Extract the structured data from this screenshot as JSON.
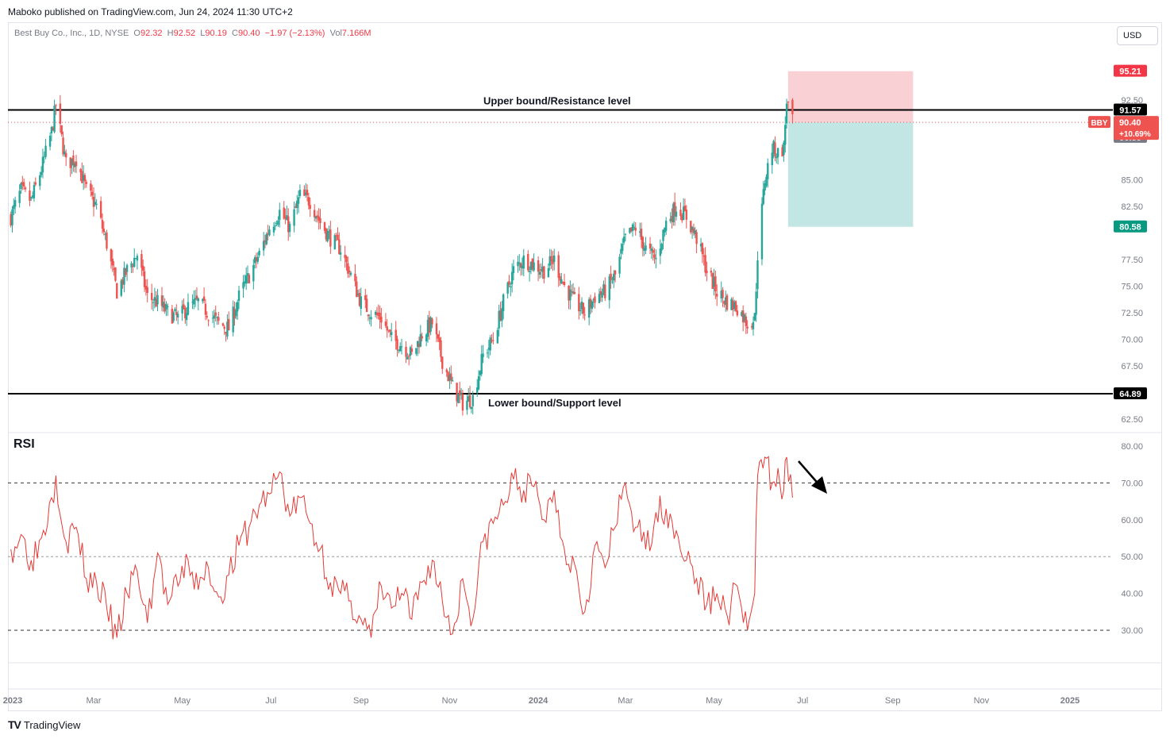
{
  "header": {
    "publisher": "Maboko published on TradingView.com, Jun 24, 2024 11:30 UTC+2"
  },
  "legend": {
    "symbol": "Best Buy Co., Inc., 1D, NYSE",
    "o_label": "O",
    "o": "92.32",
    "h_label": "H",
    "h": "92.52",
    "l_label": "L",
    "l": "90.19",
    "c_label": "C",
    "c": "90.40",
    "change": "−1.97 (−2.13%)",
    "vol_label": "Vol",
    "vol": "7.166M"
  },
  "currency": "USD",
  "footer": {
    "logo_mark": "TV",
    "logo_text": "TradingView"
  },
  "colors": {
    "up": "#26a69a",
    "down": "#ef5350",
    "rsi": "#e53935",
    "loss_zone": "#f8c8cc",
    "profit_zone": "#bfe5e1"
  },
  "chart_data": [
    {
      "type": "candlestick",
      "title": "",
      "symbol": "BBY",
      "x_start": "2023-01-03",
      "x_end": "2024-06-24",
      "ylim": [
        61.5,
        97.2
      ],
      "y_ticks": [
        "62.50",
        "67.50",
        "70.00",
        "72.50",
        "75.00",
        "77.50",
        "85.00",
        "82.50",
        "92.50"
      ],
      "close_path": [
        [
          "2023-01-03",
          81.5
        ],
        [
          "2023-01-10",
          84.0
        ],
        [
          "2023-01-17",
          83.0
        ],
        [
          "2023-01-24",
          86.0
        ],
        [
          "2023-01-31",
          89.5
        ],
        [
          "2023-02-03",
          92.0
        ],
        [
          "2023-02-10",
          86.5
        ],
        [
          "2023-02-17",
          87.0
        ],
        [
          "2023-02-24",
          84.0
        ],
        [
          "2023-03-03",
          82.5
        ],
        [
          "2023-03-10",
          79.0
        ],
        [
          "2023-03-17",
          74.5
        ],
        [
          "2023-03-24",
          76.5
        ],
        [
          "2023-03-31",
          78.0
        ],
        [
          "2023-04-07",
          74.0
        ],
        [
          "2023-04-14",
          73.5
        ],
        [
          "2023-04-21",
          72.5
        ],
        [
          "2023-04-28",
          72.0
        ],
        [
          "2023-05-05",
          73.0
        ],
        [
          "2023-05-12",
          73.5
        ],
        [
          "2023-05-19",
          72.5
        ],
        [
          "2023-05-26",
          71.5
        ],
        [
          "2023-06-02",
          71.0
        ],
        [
          "2023-06-09",
          74.0
        ],
        [
          "2023-06-16",
          76.0
        ],
        [
          "2023-06-23",
          78.0
        ],
        [
          "2023-06-30",
          80.5
        ],
        [
          "2023-07-07",
          82.0
        ],
        [
          "2023-07-14",
          80.5
        ],
        [
          "2023-07-21",
          83.5
        ],
        [
          "2023-07-28",
          83.0
        ],
        [
          "2023-08-04",
          81.0
        ],
        [
          "2023-08-11",
          79.5
        ],
        [
          "2023-08-18",
          78.5
        ],
        [
          "2023-08-25",
          76.0
        ],
        [
          "2023-09-01",
          73.5
        ],
        [
          "2023-09-08",
          72.5
        ],
        [
          "2023-09-15",
          72.0
        ],
        [
          "2023-09-22",
          70.0
        ],
        [
          "2023-09-29",
          69.5
        ],
        [
          "2023-10-06",
          68.5
        ],
        [
          "2023-10-13",
          70.5
        ],
        [
          "2023-10-20",
          71.5
        ],
        [
          "2023-10-27",
          68.0
        ],
        [
          "2023-11-03",
          65.5
        ],
        [
          "2023-11-10",
          64.0
        ],
        [
          "2023-11-17",
          64.5
        ],
        [
          "2023-11-24",
          68.5
        ],
        [
          "2023-12-01",
          70.0
        ],
        [
          "2023-12-08",
          73.5
        ],
        [
          "2023-12-15",
          76.5
        ],
        [
          "2023-12-22",
          77.5
        ],
        [
          "2023-12-29",
          77.0
        ],
        [
          "2024-01-05",
          76.5
        ],
        [
          "2024-01-12",
          77.5
        ],
        [
          "2024-01-19",
          75.0
        ],
        [
          "2024-01-26",
          73.5
        ],
        [
          "2024-02-02",
          72.5
        ],
        [
          "2024-02-09",
          74.0
        ],
        [
          "2024-02-16",
          74.5
        ],
        [
          "2024-02-23",
          76.0
        ],
        [
          "2024-03-01",
          79.5
        ],
        [
          "2024-03-08",
          80.5
        ],
        [
          "2024-03-15",
          78.5
        ],
        [
          "2024-03-22",
          77.5
        ],
        [
          "2024-03-29",
          81.0
        ],
        [
          "2024-04-05",
          82.5
        ],
        [
          "2024-04-12",
          81.5
        ],
        [
          "2024-04-19",
          79.5
        ],
        [
          "2024-04-26",
          76.5
        ],
        [
          "2024-05-03",
          74.5
        ],
        [
          "2024-05-10",
          73.5
        ],
        [
          "2024-05-17",
          73.0
        ],
        [
          "2024-05-24",
          71.5
        ],
        [
          "2024-05-29",
          72.0
        ],
        [
          "2024-05-31",
          78.0
        ],
        [
          "2024-06-05",
          85.0
        ],
        [
          "2024-06-10",
          88.0
        ],
        [
          "2024-06-14",
          87.5
        ],
        [
          "2024-06-18",
          88.0
        ],
        [
          "2024-06-20",
          92.5
        ],
        [
          "2024-06-24",
          90.4
        ]
      ],
      "levels": [
        {
          "name": "Upper bound/Resistance level",
          "value": 91.57,
          "label": "91.57"
        },
        {
          "name": "Lower bound/Support level",
          "value": 64.89,
          "label": "64.89"
        }
      ],
      "position": {
        "entry": 90.4,
        "stop": 95.21,
        "target": 80.58,
        "from": "2024-06-21",
        "to": "2024-09-15"
      },
      "price_labels": [
        {
          "name": "stop",
          "value": 95.21,
          "text": "95.21",
          "color": "#f23645"
        },
        {
          "name": "target",
          "value": 80.58,
          "text": "80.58",
          "color": "#089981"
        },
        {
          "name": "bid",
          "value": 89.0,
          "text": "90.38",
          "color": "#787b86"
        }
      ],
      "last_price": {
        "ticker": "BBY",
        "price": "90.40",
        "change": "+10.69%"
      }
    },
    {
      "type": "line",
      "title": "RSI",
      "ylim": [
        22,
        83
      ],
      "y_ticks": [
        "80.00",
        "70.00",
        "60.00",
        "50.00",
        "40.00",
        "30.00"
      ],
      "levels": [
        70,
        50,
        30
      ],
      "series": [
        {
          "values": [
            [
              "2023-01-03",
              52
            ],
            [
              "2023-01-10",
              56
            ],
            [
              "2023-01-17",
              49
            ],
            [
              "2023-01-24",
              55
            ],
            [
              "2023-01-31",
              66
            ],
            [
              "2023-02-03",
              72
            ],
            [
              "2023-02-10",
              54
            ],
            [
              "2023-02-17",
              58
            ],
            [
              "2023-02-24",
              44
            ],
            [
              "2023-03-03",
              43
            ],
            [
              "2023-03-10",
              36
            ],
            [
              "2023-03-17",
              28
            ],
            [
              "2023-03-24",
              40
            ],
            [
              "2023-03-31",
              46
            ],
            [
              "2023-04-07",
              32
            ],
            [
              "2023-04-14",
              51
            ],
            [
              "2023-04-21",
              37
            ],
            [
              "2023-04-28",
              42
            ],
            [
              "2023-05-05",
              49
            ],
            [
              "2023-05-12",
              41
            ],
            [
              "2023-05-19",
              47
            ],
            [
              "2023-05-26",
              39
            ],
            [
              "2023-06-02",
              45
            ],
            [
              "2023-06-09",
              53
            ],
            [
              "2023-06-16",
              58
            ],
            [
              "2023-06-23",
              64
            ],
            [
              "2023-06-30",
              67
            ],
            [
              "2023-07-07",
              73
            ],
            [
              "2023-07-14",
              61
            ],
            [
              "2023-07-21",
              66
            ],
            [
              "2023-07-28",
              59
            ],
            [
              "2023-08-04",
              52
            ],
            [
              "2023-08-11",
              43
            ],
            [
              "2023-08-18",
              40
            ],
            [
              "2023-08-25",
              38
            ],
            [
              "2023-09-01",
              33
            ],
            [
              "2023-09-08",
              28
            ],
            [
              "2023-09-15",
              42
            ],
            [
              "2023-09-22",
              36
            ],
            [
              "2023-09-29",
              40
            ],
            [
              "2023-10-06",
              33
            ],
            [
              "2023-10-13",
              43
            ],
            [
              "2023-10-20",
              49
            ],
            [
              "2023-10-27",
              38
            ],
            [
              "2023-11-03",
              29
            ],
            [
              "2023-11-10",
              44
            ],
            [
              "2023-11-17",
              33
            ],
            [
              "2023-11-24",
              54
            ],
            [
              "2023-12-01",
              59
            ],
            [
              "2023-12-08",
              64
            ],
            [
              "2023-12-15",
              71
            ],
            [
              "2023-12-22",
              68
            ],
            [
              "2023-12-29",
              69
            ],
            [
              "2024-01-05",
              60
            ],
            [
              "2024-01-12",
              68
            ],
            [
              "2024-01-19",
              52
            ],
            [
              "2024-01-26",
              48
            ],
            [
              "2024-02-02",
              35
            ],
            [
              "2024-02-09",
              53
            ],
            [
              "2024-02-16",
              47
            ],
            [
              "2024-02-23",
              58
            ],
            [
              "2024-03-01",
              70
            ],
            [
              "2024-03-08",
              58
            ],
            [
              "2024-03-15",
              52
            ],
            [
              "2024-03-22",
              62
            ],
            [
              "2024-03-29",
              63
            ],
            [
              "2024-04-05",
              57
            ],
            [
              "2024-04-12",
              49
            ],
            [
              "2024-04-19",
              44
            ],
            [
              "2024-04-26",
              37
            ],
            [
              "2024-05-03",
              40
            ],
            [
              "2024-05-10",
              34
            ],
            [
              "2024-05-17",
              42
            ],
            [
              "2024-05-24",
              30
            ],
            [
              "2024-05-29",
              40
            ],
            [
              "2024-05-31",
              72
            ],
            [
              "2024-06-05",
              77
            ],
            [
              "2024-06-10",
              70
            ],
            [
              "2024-06-14",
              74
            ],
            [
              "2024-06-18",
              68
            ],
            [
              "2024-06-20",
              77
            ],
            [
              "2024-06-24",
              66
            ]
          ]
        }
      ]
    }
  ],
  "x_axis": {
    "ticks": [
      {
        "label": "2023",
        "date": "2023-01-01"
      },
      {
        "label": "Mar",
        "date": "2023-03-01"
      },
      {
        "label": "May",
        "date": "2023-05-01"
      },
      {
        "label": "Jul",
        "date": "2023-07-01"
      },
      {
        "label": "Sep",
        "date": "2023-09-01"
      },
      {
        "label": "Nov",
        "date": "2023-11-01"
      },
      {
        "label": "2024",
        "date": "2024-01-01"
      },
      {
        "label": "Mar",
        "date": "2024-03-01"
      },
      {
        "label": "May",
        "date": "2024-05-01"
      },
      {
        "label": "Jul",
        "date": "2024-07-01"
      },
      {
        "label": "Sep",
        "date": "2024-09-01"
      },
      {
        "label": "Nov",
        "date": "2024-11-01"
      },
      {
        "label": "2025",
        "date": "2025-01-01"
      }
    ]
  }
}
